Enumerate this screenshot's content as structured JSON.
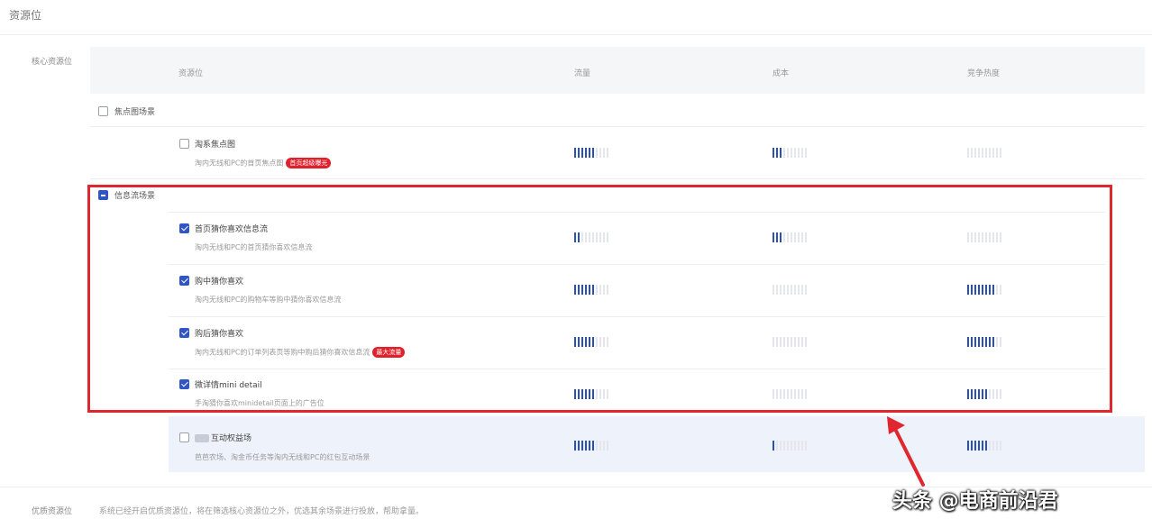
{
  "page": {
    "title": "资源位"
  },
  "sections": {
    "core_label": "核心资源位",
    "quality_label": "优质资源位"
  },
  "table": {
    "headers": [
      "资源位",
      "流量",
      "成本",
      "竞争热度"
    ]
  },
  "groups": [
    {
      "name": "焦点图场景",
      "state": "unchecked"
    },
    {
      "name": "信息流场景",
      "state": "half"
    }
  ],
  "items": [
    {
      "name": "淘系焦点图",
      "desc": "淘内无线和PC的首页焦点图",
      "tag": "首页超级曝光",
      "checked": false,
      "levels": {
        "traffic": 0.6,
        "cost": 0.3,
        "heat": 0.0
      }
    },
    {
      "name": "首页猜你喜欢信息流",
      "desc": "淘内无线和PC的首页猜你喜欢信息流",
      "tag": "",
      "checked": true,
      "levels": {
        "traffic": 0.2,
        "cost": 0.3,
        "heat": 0.0
      }
    },
    {
      "name": "购中猜你喜欢",
      "desc": "淘内无线和PC的购物车等购中猜你喜欢信息流",
      "tag": "",
      "checked": true,
      "levels": {
        "traffic": 0.6,
        "cost": 0.0,
        "heat": 0.8
      }
    },
    {
      "name": "购后猜你喜欢",
      "desc": "淘内无线和PC的订单列表页等购中购后猜你喜欢信息流",
      "tag": "最大流量",
      "checked": true,
      "levels": {
        "traffic": 0.6,
        "cost": 0.0,
        "heat": 0.8
      }
    },
    {
      "name": "微详情mini detail",
      "desc": "手淘猜你喜欢minidetail页面上的广告位",
      "tag": "",
      "checked": true,
      "levels": {
        "traffic": 0.6,
        "cost": 0.0,
        "heat": 0.6
      }
    },
    {
      "name": "互动权益场",
      "desc": "芭芭农场、淘金币任务等淘内无线和PC的红包互动场景",
      "tag": "",
      "checked": false,
      "levels": {
        "traffic": 0.6,
        "cost": 0.1,
        "heat": 0.6
      }
    }
  ],
  "footer": {
    "desc": "系统已经开启优质资源位，将在筛选核心资源位之外，优选其余场景进行投放，帮助拿量。"
  },
  "watermark": "头条 @电商前沿君",
  "colors": {
    "accent": "#2f56c4",
    "highlight": "#e0262e",
    "bar_on": "#2b50b8"
  }
}
